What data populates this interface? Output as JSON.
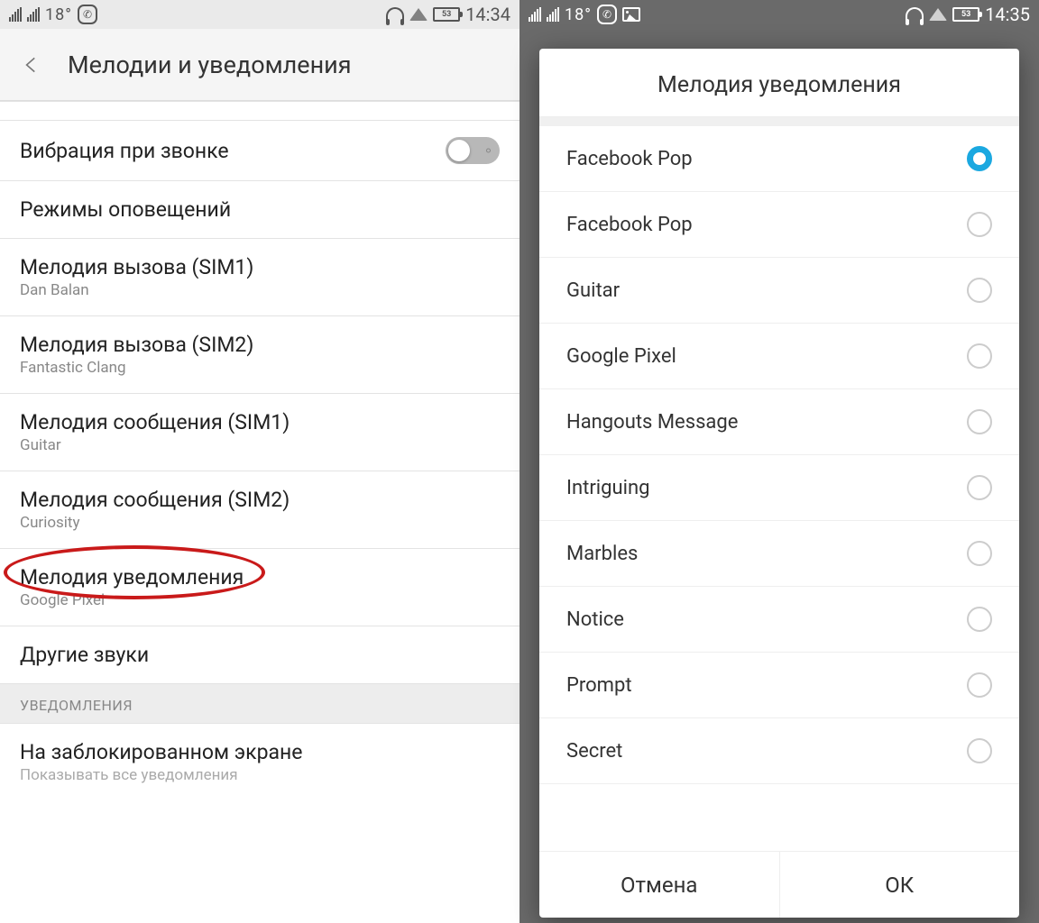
{
  "left": {
    "status": {
      "temp": "18°",
      "battery": "53",
      "time": "14:34"
    },
    "title": "Мелодии и уведомления",
    "rows": {
      "vibrate": "Вибрация при звонке",
      "modes": "Режимы оповещений",
      "sim1_t": "Мелодия вызова (SIM1)",
      "sim1_s": "Dan Balan",
      "sim2_t": "Мелодия вызова (SIM2)",
      "sim2_s": "Fantastic Clang",
      "msg1_t": "Мелодия сообщения (SIM1)",
      "msg1_s": "Guitar",
      "msg2_t": "Мелодия сообщения (SIM2)",
      "msg2_s": "Curiosity",
      "notif_t": "Мелодия уведомления",
      "notif_s": "Google Pixel",
      "other": "Другие звуки",
      "section": "УВЕДОМЛЕНИЯ",
      "lock_t": "На заблокированном экране",
      "lock_s": "Показывать все уведомления"
    }
  },
  "right": {
    "status": {
      "temp": "18°",
      "battery": "53",
      "time": "14:35"
    },
    "dialog_title": "Мелодия уведомления",
    "options": [
      {
        "label": "Facebook Pop",
        "selected": true
      },
      {
        "label": "Facebook Pop",
        "selected": false
      },
      {
        "label": "Guitar",
        "selected": false
      },
      {
        "label": "Google Pixel",
        "selected": false
      },
      {
        "label": "Hangouts Message",
        "selected": false
      },
      {
        "label": "Intriguing",
        "selected": false
      },
      {
        "label": "Marbles",
        "selected": false
      },
      {
        "label": "Notice",
        "selected": false
      },
      {
        "label": "Prompt",
        "selected": false
      },
      {
        "label": "Secret",
        "selected": false
      }
    ],
    "cancel": "Отмена",
    "ok": "ОК"
  }
}
